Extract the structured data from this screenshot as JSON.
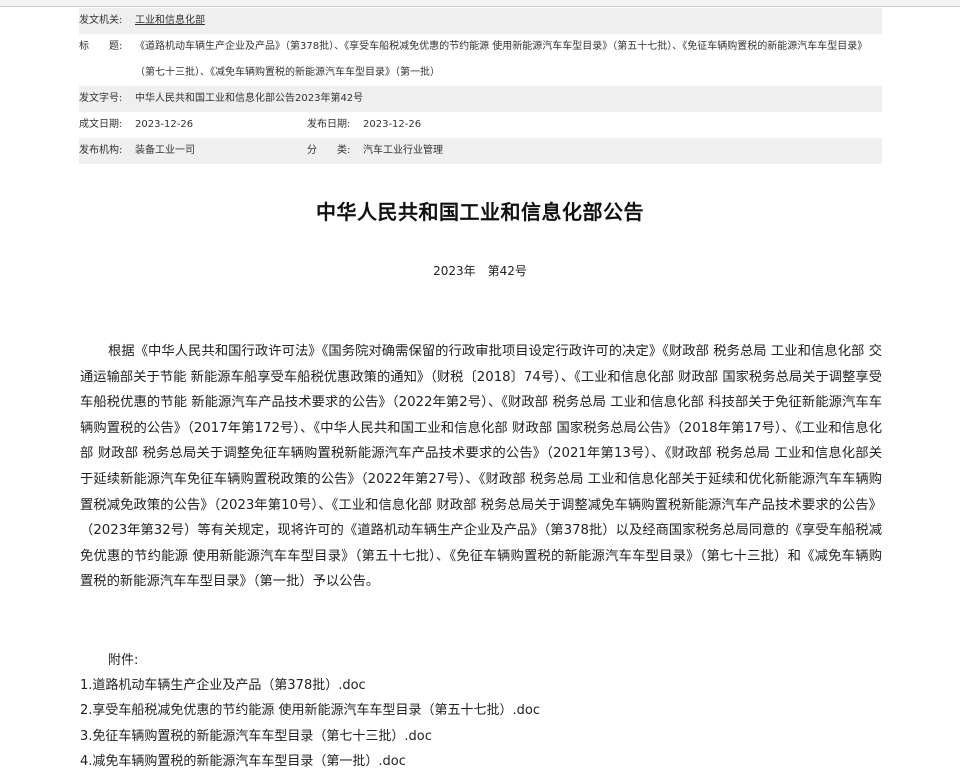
{
  "meta": {
    "issuer_label": "发文机关:",
    "issuer_value": "工业和信息化部",
    "title_label": "标　　题:",
    "title_value": "《道路机动车辆生产企业及产品》（第378批）、《享受车船税减免优惠的节约能源 使用新能源汽车车型目录》（第五十七批）、《免征车辆购置税的新能源汽车车型目录》（第七十三批）、《减免车辆购置税的新能源汽车车型目录》（第一批）",
    "docno_label": "发文字号:",
    "docno_value": "中华人民共和国工业和信息化部公告2023年第42号",
    "written_label": "成文日期:",
    "written_value": "2023-12-26",
    "published_label": "发布日期:",
    "published_value": "2023-12-26",
    "org_label": "发布机构:",
    "org_value": "装备工业一司",
    "category_label": "分　　类:",
    "category_value": "汽车工业行业管理"
  },
  "document": {
    "title": "中华人民共和国工业和信息化部公告",
    "number": "2023年　第42号",
    "body": "根据《中华人民共和国行政许可法》《国务院对确需保留的行政审批项目设定行政许可的决定》《财政部 税务总局 工业和信息化部 交通运输部关于节能 新能源车船享受车船税优惠政策的通知》（财税〔2018〕74号）、《工业和信息化部 财政部 国家税务总局关于调整享受车船税优惠的节能 新能源汽车产品技术要求的公告》（2022年第2号）、《财政部 税务总局 工业和信息化部 科技部关于免征新能源汽车车辆购置税的公告》（2017年第172号）、《中华人民共和国工业和信息化部 财政部 国家税务总局公告》（2018年第17号）、《工业和信息化部 财政部 税务总局关于调整免征车辆购置税新能源汽车产品技术要求的公告》（2021年第13号）、《财政部 税务总局 工业和信息化部关于延续新能源汽车免征车辆购置税政策的公告》（2022年第27号）、《财政部 税务总局 工业和信息化部关于延续和优化新能源汽车车辆购置税减免政策的公告》（2023年第10号）、《工业和信息化部 财政部 税务总局关于调整减免车辆购置税新能源汽车产品技术要求的公告》（2023年第32号）等有关规定，现将许可的《道路机动车辆生产企业及产品》（第378批）以及经商国家税务总局同意的《享受车船税减免优惠的节约能源 使用新能源汽车车型目录》（第五十七批）、《免征车辆购置税的新能源汽车车型目录》（第七十三批）和《减免车辆购置税的新能源汽车车型目录》（第一批）予以公告。",
    "attachments_label": "附件:",
    "attachments": [
      "1.道路机动车辆生产企业及产品（第378批）.doc",
      "2.享受车船税减免优惠的节约能源 使用新能源汽车车型目录（第五十七批）.doc",
      "3.免征车辆购置税的新能源汽车车型目录（第七十三批）.doc",
      "4.减免车辆购置税的新能源汽车车型目录（第一批）.doc"
    ]
  }
}
